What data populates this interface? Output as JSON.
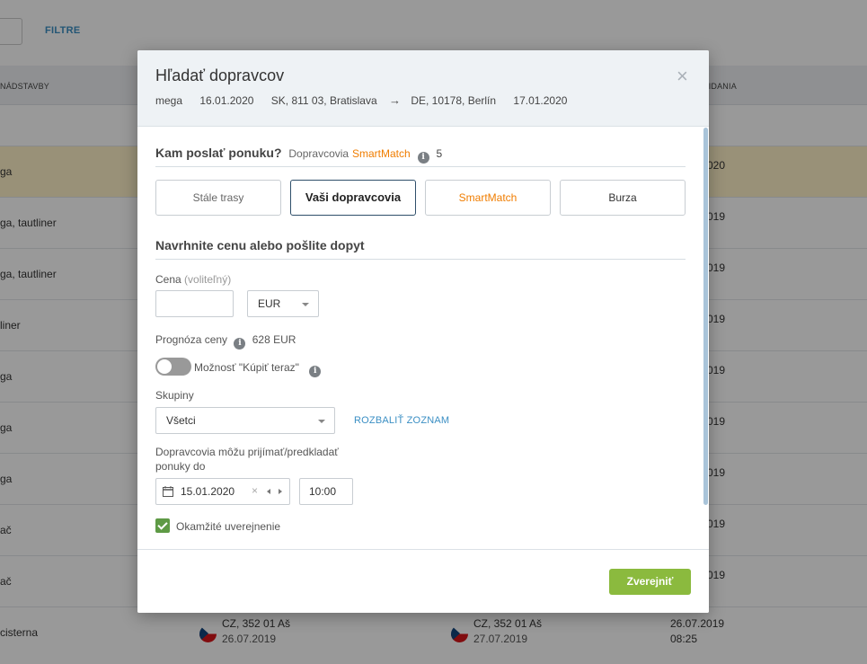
{
  "background": {
    "filter_label": "FILTRE",
    "col_left": "NÁDSTAVBY",
    "col_right": "RIDANIA",
    "rows": [
      {
        "name": "ga",
        "date": "020",
        "highlight": true
      },
      {
        "name": "ga, tautliner",
        "date": "019"
      },
      {
        "name": "ga, tautliner",
        "date": "019"
      },
      {
        "name": "liner",
        "date": "019"
      },
      {
        "name": "ga",
        "date": "019"
      },
      {
        "name": "ga",
        "date": "019"
      },
      {
        "name": "ga",
        "date": "019"
      },
      {
        "name": "ač",
        "date": "019"
      },
      {
        "name": "ač",
        "date": "019"
      }
    ],
    "last_row": {
      "name": "cisterna",
      "from_place": "CZ, 352 01 Aš",
      "from_date": "26.07.2019",
      "to_place": "CZ, 352 01 Aš",
      "to_date": "27.07.2019",
      "added_date": "26.07.2019",
      "added_time": "08:25"
    }
  },
  "modal": {
    "title": "Hľadať dopravcov",
    "close": "×",
    "route": {
      "body": "mega",
      "load_date": "16.01.2020",
      "from": "SK, 811 03, Bratislava",
      "arrow": "→",
      "to": "DE, 10178, Berlín",
      "unload_date": "17.01.2020"
    },
    "send_section": {
      "title": "Kam poslať ponuku?",
      "meta_prefix": "Dopravcovia",
      "brand": "SmartMatch",
      "count": "5"
    },
    "tabs": [
      {
        "label": "Stále trasy"
      },
      {
        "label": "Vaši dopravcovia"
      },
      {
        "label": "SmartMatch"
      },
      {
        "label": "Burza"
      }
    ],
    "price_section": {
      "title": "Navrhnite cenu alebo pošlite dopyt",
      "price_label": "Cena",
      "price_optional": "(voliteľný)",
      "price_value": "",
      "currency": "EUR",
      "forecast_label": "Prognóza ceny",
      "forecast_value": "628 EUR",
      "buy_now_label": "Možnosť \"Kúpiť teraz\"",
      "groups_label": "Skupiny",
      "groups_value": "Všetci",
      "expand_link": "ROZBALIŤ ZOZNAM",
      "deadline_label_1": "Dopravcovia môžu prijímať/predkladať",
      "deadline_label_2": "ponuky do",
      "deadline_date": "15.01.2020",
      "deadline_time": "10:00",
      "instant_label": "Okamžité uverejnenie"
    },
    "publish_button": "Zverejniť"
  }
}
